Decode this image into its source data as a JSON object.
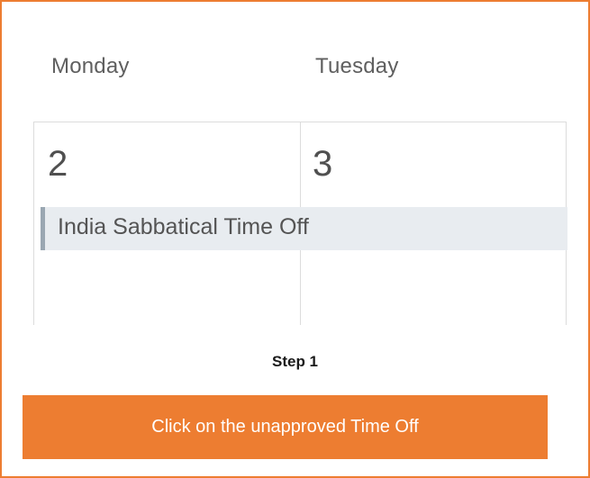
{
  "calendar": {
    "headers": [
      "Monday",
      "Tuesday"
    ],
    "dates": [
      "2",
      "3"
    ],
    "event": {
      "label": "India Sabbatical Time Off"
    }
  },
  "instructions": {
    "step": "Step 1",
    "callout": "Click on the unapproved Time Off"
  },
  "colors": {
    "accent": "#ed7d31",
    "event_background": "#e8ecf0",
    "event_marker": "#9aa7b2"
  }
}
